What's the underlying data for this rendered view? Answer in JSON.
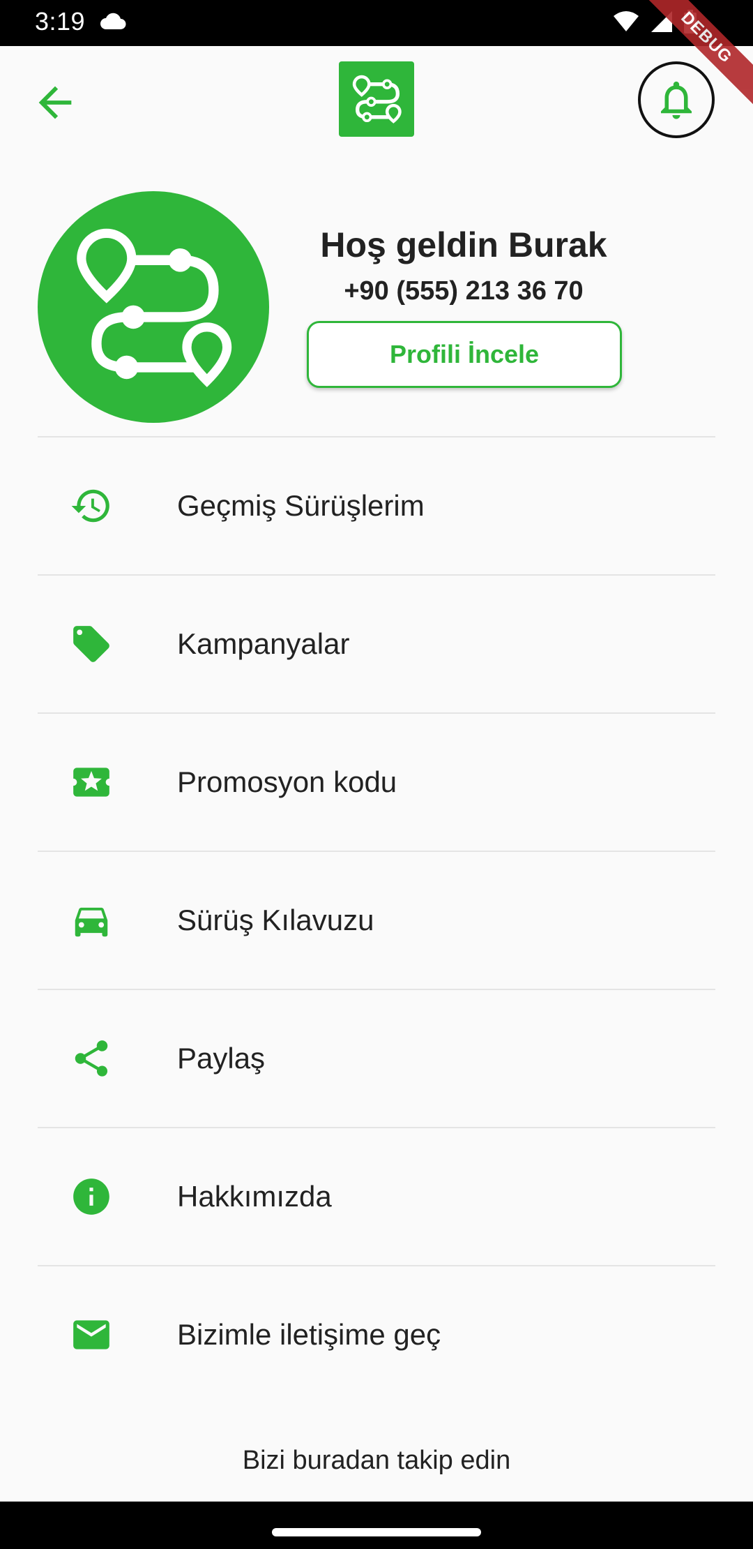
{
  "status_bar": {
    "time": "3:19",
    "debug_label": "DEBUG"
  },
  "app_bar": {
    "back_icon": "arrow-back-icon",
    "logo_icon": "route-logo-icon",
    "bell_icon": "notification-bell-icon"
  },
  "profile": {
    "greeting": "Hoş geldin Burak",
    "phone": "+90 (555) 213 36 70",
    "button_label": "Profili İncele"
  },
  "menu": {
    "items": [
      {
        "label": "Geçmiş Sürüşlerim",
        "icon": "history-icon"
      },
      {
        "label": "Kampanyalar",
        "icon": "tag-icon"
      },
      {
        "label": "Promosyon kodu",
        "icon": "ticket-star-icon"
      },
      {
        "label": "Sürüş Kılavuzu",
        "icon": "car-icon"
      },
      {
        "label": "Paylaş",
        "icon": "share-icon"
      },
      {
        "label": "Hakkımızda",
        "icon": "info-icon"
      },
      {
        "label": "Bizimle iletişime geç",
        "icon": "mail-icon"
      }
    ]
  },
  "footer": {
    "follow_text": "Bizi buradan takip edin"
  },
  "colors": {
    "accent": "#2fb63a",
    "text": "#222222",
    "divider": "#e4e4e4",
    "background": "#fafafa"
  }
}
